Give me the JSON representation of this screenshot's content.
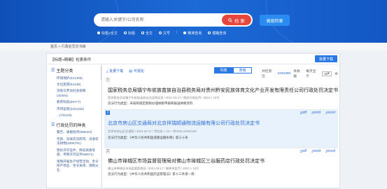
{
  "search": {
    "placeholder": "请输入关键字/公司名称",
    "button_label": "检 索",
    "advanced_label": "高级检索"
  },
  "filters": [
    {
      "label": "标题+全文",
      "selected": true
    },
    {
      "label": "标题",
      "selected": false
    },
    {
      "label": "全文",
      "selected": false
    },
    {
      "label": "文号",
      "selected": false
    },
    {
      "label": "精准查询",
      "selected": true
    },
    {
      "label": "模糊查询",
      "selected": false
    }
  ],
  "breadcrumb": "首页 > 行政处罚文书库",
  "panel": {
    "header": "【标题+精确】检索条件",
    "condition_text": "",
    "download_label": "批量下载"
  },
  "sidebar": {
    "sec1_title": "主题分类",
    "sec1_items": [
      {
        "label": "环境保护",
        "count": "(421405)"
      },
      {
        "label": "文化旅游",
        "count": "(51439)"
      },
      {
        "label": "消防与劳动社会保障",
        "count": "(40484)"
      },
      {
        "label": "教育科技",
        "count": "(89777)"
      },
      {
        "label": "市场监管",
        "count": "(3161152)"
      },
      {
        "label": "...",
        "count": "(731115)"
      }
    ],
    "sec2_title": "行政处罚的种类",
    "sec2_items": [
      {
        "label": "警告、通报批评",
        "count": "(588322)"
      },
      {
        "label": "罚款、没收违法所得、没收非法财物",
        "count": "(3305791)"
      },
      {
        "label": "暂扣许可证件、降低资质等级、吊销许可证件",
        "count": "(58871)"
      },
      {
        "label": "限制开展生产经营活动、责令停产停业、责令关闭、限制从业",
        "count": ""
      }
    ]
  },
  "toolbar": {
    "batch_download": "批量下载",
    "visualize": "可视化",
    "tab_list": "列表",
    "tab_grid": "表格",
    "result_prefix": "共检索出",
    "result_count": "3263390",
    "result_suffix": "条数据",
    "page_size_label": "每页显示",
    "page_size": "10",
    "page_size_unit": "条"
  },
  "results": [
    {
      "n": "1",
      "title": "国家税务总局镇宁布依族苗族自治县税务局对贵州黔安民族体育文化产业开发有限责任公司行政处罚决定书",
      "meta": "国家税务总局镇宁布依族苗族自治县税务局 / 2021-03-17 / 税务行政处罚 / 2023 > 10号",
      "gist": "违法行为类型：未按照规定期限办理纳税申报和报送纳税资料",
      "actions": [
        "pdf",
        "word",
        "excel"
      ],
      "highlighted": false
    },
    {
      "n": "2",
      "title": "北京市房山区交通局对北京祥瑞顺通物流运输有限公司行政处罚决定书",
      "meta": "北京市房山区交通局 / 2021-03-17 / 京交执 > 23 > 京HNO.A2042159",
      "gist": "违法行为类型：《中华人民共和国道路运输条例》第三十条",
      "actions": [
        "pdf",
        "word",
        "excel"
      ],
      "highlighted": true
    },
    {
      "n": "3",
      "title": "佛山市禅城区市场监督管理局对佛山市禅城区三谷服药店行政处罚决定书",
      "meta": "佛山市禅城区市场监督管理局 / 2021-03-17 / 佛禅市监罚 / 2023 > 19号",
      "gist": "违法行为类型：《中华人民共和国药品管理法》第十三条第一款",
      "actions": [
        "pdf",
        "word",
        "excel"
      ],
      "highlighted": false
    }
  ],
  "colors": {
    "hero": "#1c6ad6",
    "search_button": "#e8453c",
    "accent": "#2a78e4"
  }
}
